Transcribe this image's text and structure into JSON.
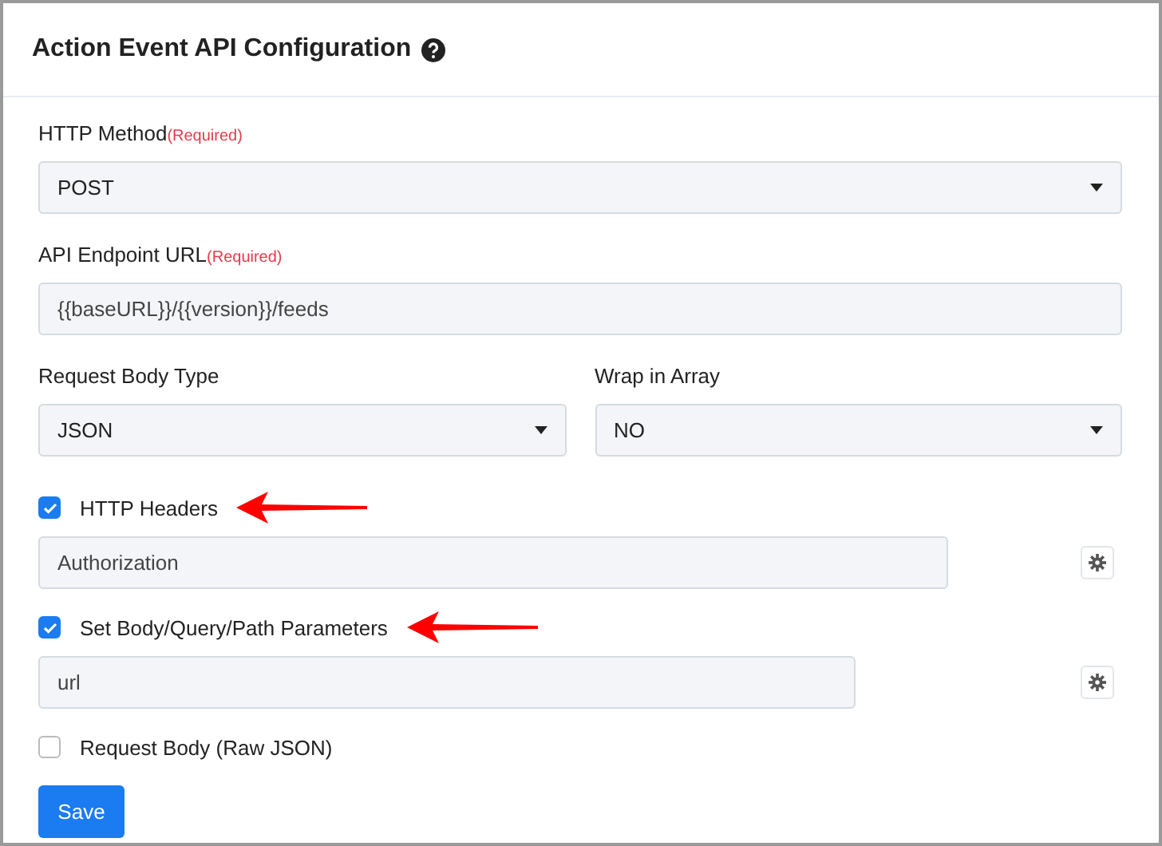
{
  "panel": {
    "title": "Action Event API Configuration"
  },
  "fields": [
    {
      "label": "HTTP Method",
      "note": "(Required)",
      "kind": "select",
      "value": "POST"
    },
    {
      "label": "API Endpoint URL",
      "note": "(Required)",
      "kind": "input",
      "value": "{{baseURL}}/{{version}}/feeds"
    }
  ],
  "pair": [
    {
      "label": "Request Body Type",
      "kind": "select",
      "value": "JSON"
    },
    {
      "label": "Wrap in Array",
      "kind": "select",
      "value": "NO"
    }
  ],
  "options": [
    {
      "label": "HTTP Headers",
      "checked": true,
      "arrow": true,
      "value": "Authorization"
    },
    {
      "label": "Set Body/Query/Path Parameters",
      "checked": true,
      "arrow": true,
      "value": "url"
    },
    {
      "label": "Request Body (Raw JSON)",
      "checked": false,
      "arrow": false
    }
  ],
  "buttons": [
    "Save"
  ]
}
